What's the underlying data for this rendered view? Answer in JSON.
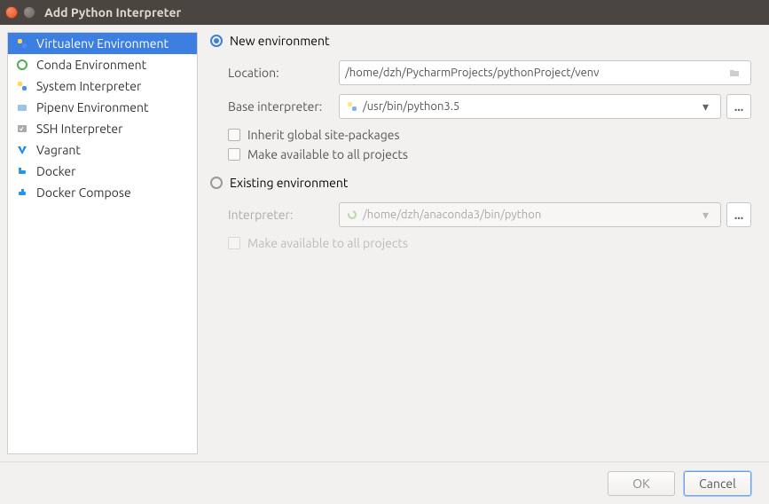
{
  "titlebar": {
    "title": "Add Python Interpreter"
  },
  "sidebar": {
    "items": [
      {
        "label": "Virtualenv Environment"
      },
      {
        "label": "Conda Environment"
      },
      {
        "label": "System Interpreter"
      },
      {
        "label": "Pipenv Environment"
      },
      {
        "label": "SSH Interpreter"
      },
      {
        "label": "Vagrant"
      },
      {
        "label": "Docker"
      },
      {
        "label": "Docker Compose"
      }
    ]
  },
  "main": {
    "new_env_label": "New environment",
    "location_label": "Location:",
    "location_value": "/home/dzh/PycharmProjects/pythonProject/venv",
    "base_interpreter_label": "Base interpreter:",
    "base_interpreter_value": "/usr/bin/python3.5",
    "inherit_label": "Inherit global site-packages",
    "make_available_label": "Make available to all projects",
    "existing_env_label": "Existing environment",
    "interpreter_label": "Interpreter:",
    "interpreter_value": "/home/dzh/anaconda3/bin/python",
    "make_available2_label": "Make available to all projects",
    "more_btn": "..."
  },
  "footer": {
    "ok": "OK",
    "cancel": "Cancel"
  }
}
